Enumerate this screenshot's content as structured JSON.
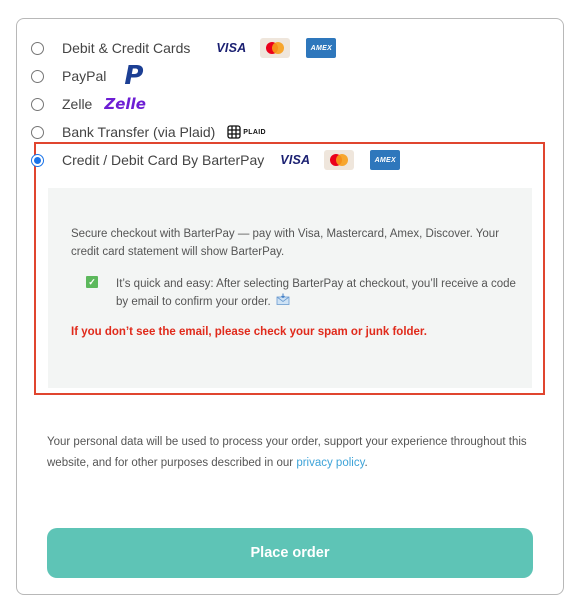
{
  "payment_methods": [
    {
      "label": "Debit & Credit Cards",
      "selected": false,
      "logos": [
        "visa-logo",
        "mastercard-logo",
        "amex-logo"
      ]
    },
    {
      "label": "PayPal",
      "selected": false,
      "logos": [
        "paypal-logo"
      ]
    },
    {
      "label": "Zelle",
      "selected": false,
      "logos": [
        "zelle-logo"
      ]
    },
    {
      "label": "Bank Transfer (via Plaid)",
      "selected": false,
      "logos": [
        "plaid-logo"
      ]
    },
    {
      "label": "Credit / Debit Card By BarterPay",
      "selected": true,
      "logos": [
        "visa-logo",
        "mastercard-logo",
        "amex-logo"
      ]
    }
  ],
  "logos": {
    "visa": "VISA",
    "amex": "AMEX",
    "zelle": "Zelle",
    "paypal": "P",
    "plaid": "PLAID"
  },
  "barterpay": {
    "secure_text": "Secure checkout with BarterPay — pay with Visa, Mastercard, Amex, Discover. Your credit card statement will show BarterPay.",
    "check_mark": "✓",
    "easy_text": "It’s quick and easy: After selecting BarterPay at checkout, you’ll receive a code by email to confirm your order.",
    "warning_text": "If you don’t see the email, please check your spam or junk folder."
  },
  "privacy": {
    "text_before": "Your personal data will be used to process your order, support your experience throughout this website, and for other purposes described in our ",
    "link_text": "privacy policy",
    "text_after": "."
  },
  "place_order_label": "Place order",
  "colors": {
    "accent_button": "#5ec4b6",
    "highlight_border": "#e0452f",
    "warning_text": "#e02a1b",
    "link": "#3ea3d8",
    "radio_selected": "#1a73e8"
  }
}
